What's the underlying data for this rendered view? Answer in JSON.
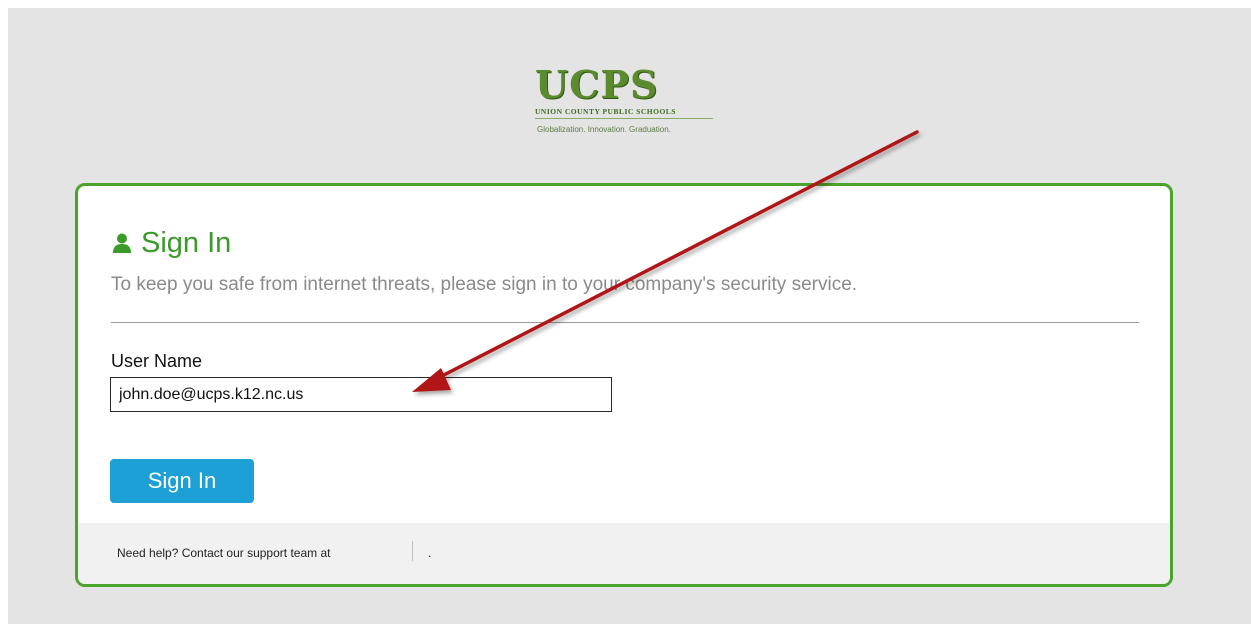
{
  "logo": {
    "name": "UCPS",
    "subtitle": "Union County Public Schools",
    "tagline": "Globalization. Innovation. Graduation."
  },
  "card": {
    "title": "Sign In",
    "subtitle": "To keep you safe from internet threats, please sign in to your company's security service.",
    "username_label": "User Name",
    "username_value": "john.doe@ucps.k12.nc.us",
    "signin_button": "Sign In",
    "footer_text": "Need help? Contact our support team at",
    "footer_trailing": "."
  },
  "colors": {
    "accent_green": "#4aa32a",
    "button_blue": "#1ca0d6",
    "annotation_arrow": "#b01212"
  },
  "icons": {
    "title_icon": "user-icon",
    "annotation": "arrow-annotation"
  }
}
